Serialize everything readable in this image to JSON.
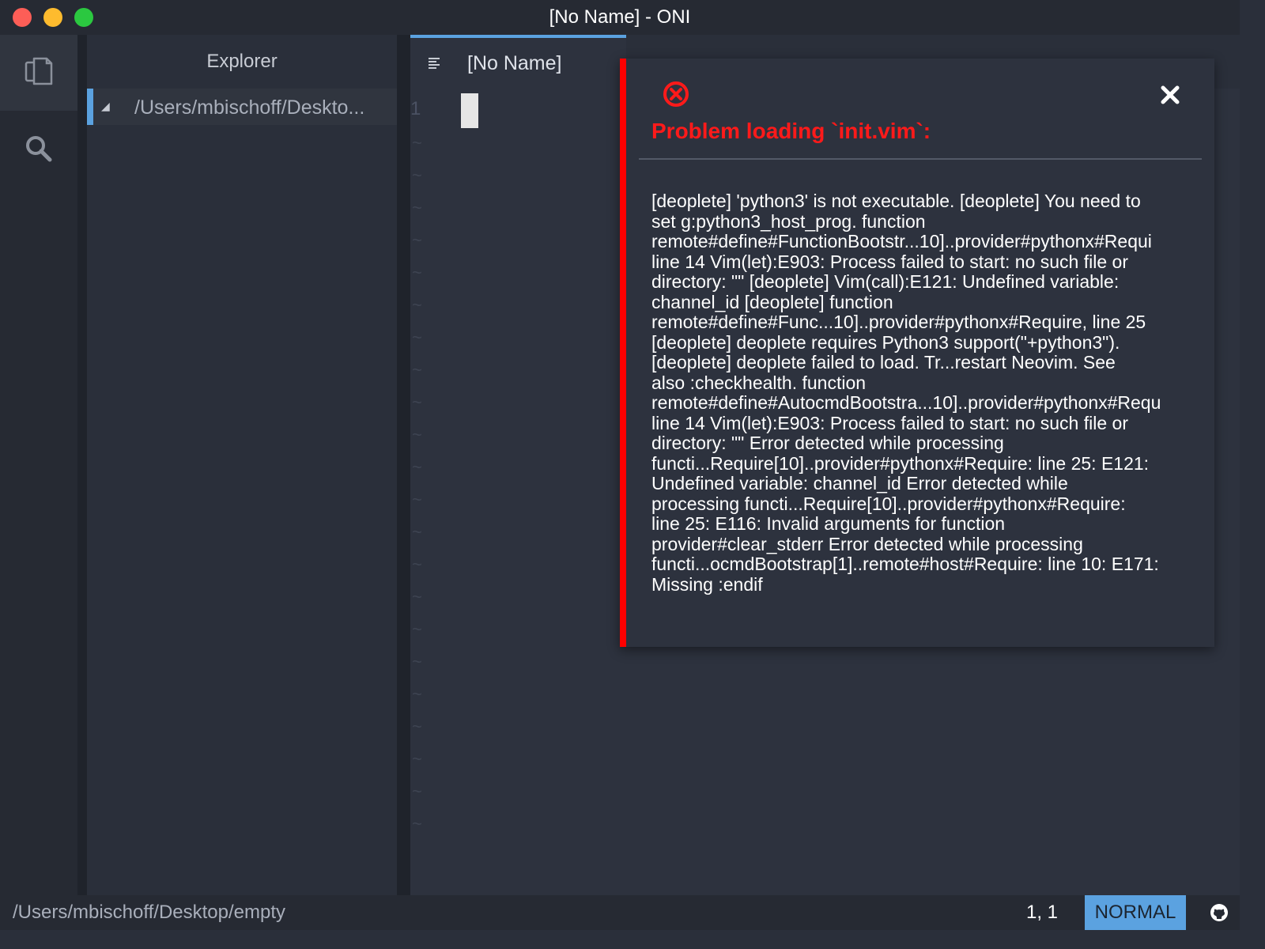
{
  "window": {
    "title": "[No Name] - ONI"
  },
  "activity_bar": {
    "items": [
      {
        "id": "explorer",
        "icon": "files-icon",
        "selected": true
      },
      {
        "id": "search",
        "icon": "search-icon",
        "selected": false
      }
    ]
  },
  "sidebar": {
    "title": "Explorer",
    "tree": [
      {
        "label": "/Users/mbischoff/Deskto...",
        "expanded": true
      }
    ]
  },
  "editor": {
    "tab": {
      "label": "[No Name]",
      "icon": "file-text-icon"
    },
    "line_numbers": [
      "1"
    ],
    "tilde": "~"
  },
  "notification": {
    "icon": "error-icon",
    "title": "Problem loading `init.vim`:",
    "message_lines": [
      "[deoplete] 'python3' is not executable. [deoplete] You need to",
      "set g:python3_host_prog. function",
      "remote#define#FunctionBootstr...10]..provider#pythonx#Requi",
      "line 14 Vim(let):E903: Process failed to start: no such file or",
      "directory: \"\" [deoplete] Vim(call):E121: Undefined variable:",
      "channel_id [deoplete] function",
      "remote#define#Func...10]..provider#pythonx#Require, line 25",
      "[deoplete] deoplete requires Python3 support(\"+python3\").",
      "[deoplete] deoplete failed to load. Tr...restart Neovim. See",
      "also :checkhealth. function",
      "remote#define#AutocmdBootstra...10]..provider#pythonx#Requ",
      "line 14 Vim(let):E903: Process failed to start: no such file or",
      "directory: \"\" Error detected while processing",
      "functi...Require[10]..provider#pythonx#Require: line 25: E121:",
      "Undefined variable: channel_id Error detected while",
      "processing functi...Require[10]..provider#pythonx#Require:",
      "line 25: E116: Invalid arguments for function",
      "provider#clear_stderr Error detected while processing",
      "functi...ocmdBootstrap[1]..remote#host#Require: line 10: E171:",
      "Missing :endif"
    ],
    "accent_color": "#ff0000"
  },
  "statusbar": {
    "path": "/Users/mbischoff/Desktop/empty",
    "position": "1, 1",
    "mode": "NORMAL",
    "icon": "github-icon",
    "mode_color": "#5ba2e0"
  }
}
